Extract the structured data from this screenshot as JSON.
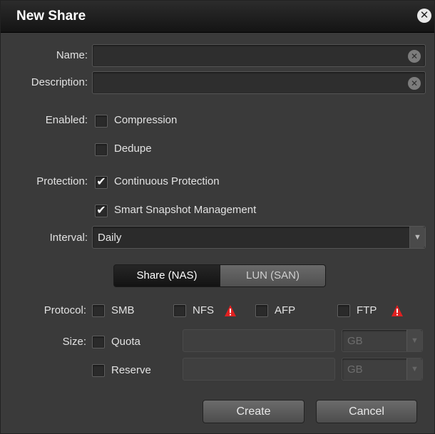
{
  "dialog": {
    "title": "New Share",
    "close_icon": "close-circle-icon"
  },
  "name": {
    "label": "Name:",
    "value": "",
    "placeholder": ""
  },
  "description": {
    "label": "Description:",
    "value": "",
    "placeholder": ""
  },
  "enabled": {
    "label": "Enabled:",
    "compression": {
      "label": "Compression",
      "checked": false
    },
    "dedupe": {
      "label": "Dedupe",
      "checked": false
    }
  },
  "protection": {
    "label": "Protection:",
    "continuous": {
      "label": "Continuous Protection",
      "checked": true
    },
    "smart_snapshot": {
      "label": "Smart Snapshot Management",
      "checked": true
    }
  },
  "interval": {
    "label": "Interval:",
    "selected": "Daily"
  },
  "share_type": {
    "options": [
      "Share (NAS)",
      "LUN (SAN)"
    ],
    "selected": "Share (NAS)"
  },
  "protocol": {
    "label": "Protocol:",
    "smb": {
      "label": "SMB",
      "checked": false
    },
    "nfs": {
      "label": "NFS",
      "checked": false,
      "warning_icon": "warning-icon"
    },
    "afp": {
      "label": "AFP",
      "checked": false
    },
    "ftp": {
      "label": "FTP",
      "checked": false,
      "warning_icon": "warning-icon"
    }
  },
  "size": {
    "label": "Size:",
    "quota": {
      "label": "Quota",
      "checked": false,
      "value": "",
      "unit": "GB"
    },
    "reserve": {
      "label": "Reserve",
      "checked": false,
      "value": "",
      "unit": "GB"
    }
  },
  "actions": {
    "create": "Create",
    "cancel": "Cancel"
  },
  "colors": {
    "warning": "#e02020",
    "titlebar": "#1a1a1a",
    "panel": "#3a3a3a"
  }
}
